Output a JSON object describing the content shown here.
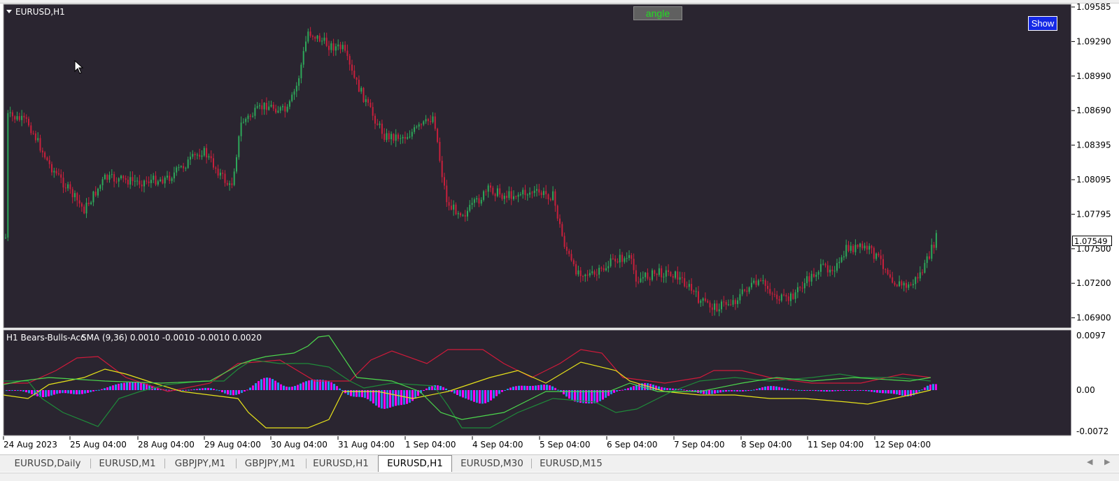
{
  "window": {
    "symbol_title": "EURUSD,H1"
  },
  "buttons": {
    "angle_label": "angle",
    "show_label": "Show"
  },
  "main_chart": {
    "price_axis": [
      "1.09585",
      "1.09290",
      "1.08990",
      "1.08690",
      "1.08395",
      "1.08095",
      "1.07795",
      "1.07500",
      "1.07200",
      "1.06900"
    ],
    "current_price": "1.07549",
    "colors": {
      "background": "#2a2530",
      "bull": "#2ea85a",
      "bear": "#c8203c",
      "text": "#ffffff"
    }
  },
  "indicator": {
    "title": "H1 Bears-Bulls-Acc",
    "params": "SMA (9,36) 0.0010 -0.0010 -0.0010 0.0020",
    "axis": [
      "0.0097",
      "0.00",
      "-0.0072"
    ],
    "colors": {
      "hist_pos": "#2196f3",
      "hist_neg": "#ff00ff",
      "line_red": "#d01a3a",
      "line_yellow": "#e6e21a",
      "line_green": "#1f8a3a",
      "line_lime": "#4cd64c"
    }
  },
  "time_axis": [
    "24 Aug 2023",
    "25 Aug 04:00",
    "28 Aug 04:00",
    "29 Aug 04:00",
    "30 Aug 04:00",
    "31 Aug 04:00",
    "1 Sep 04:00",
    "4 Sep 04:00",
    "5 Sep 04:00",
    "6 Sep 04:00",
    "7 Sep 04:00",
    "8 Sep 04:00",
    "11 Sep 04:00",
    "12 Sep 04:00"
  ],
  "tabs": [
    "EURUSD,Daily",
    "EURUSD,M1",
    "GBPJPY,M1",
    "GBPJPY,M1",
    "EURUSD,H1",
    "EURUSD,H1",
    "EURUSD,M30",
    "EURUSD,M15"
  ],
  "active_tab_index": 5,
  "icons": {
    "collapse": "triangle-down-icon",
    "cursor": "arrow-cursor-icon",
    "scroll_left": "chevron-left-icon",
    "scroll_right": "chevron-right-icon"
  }
}
